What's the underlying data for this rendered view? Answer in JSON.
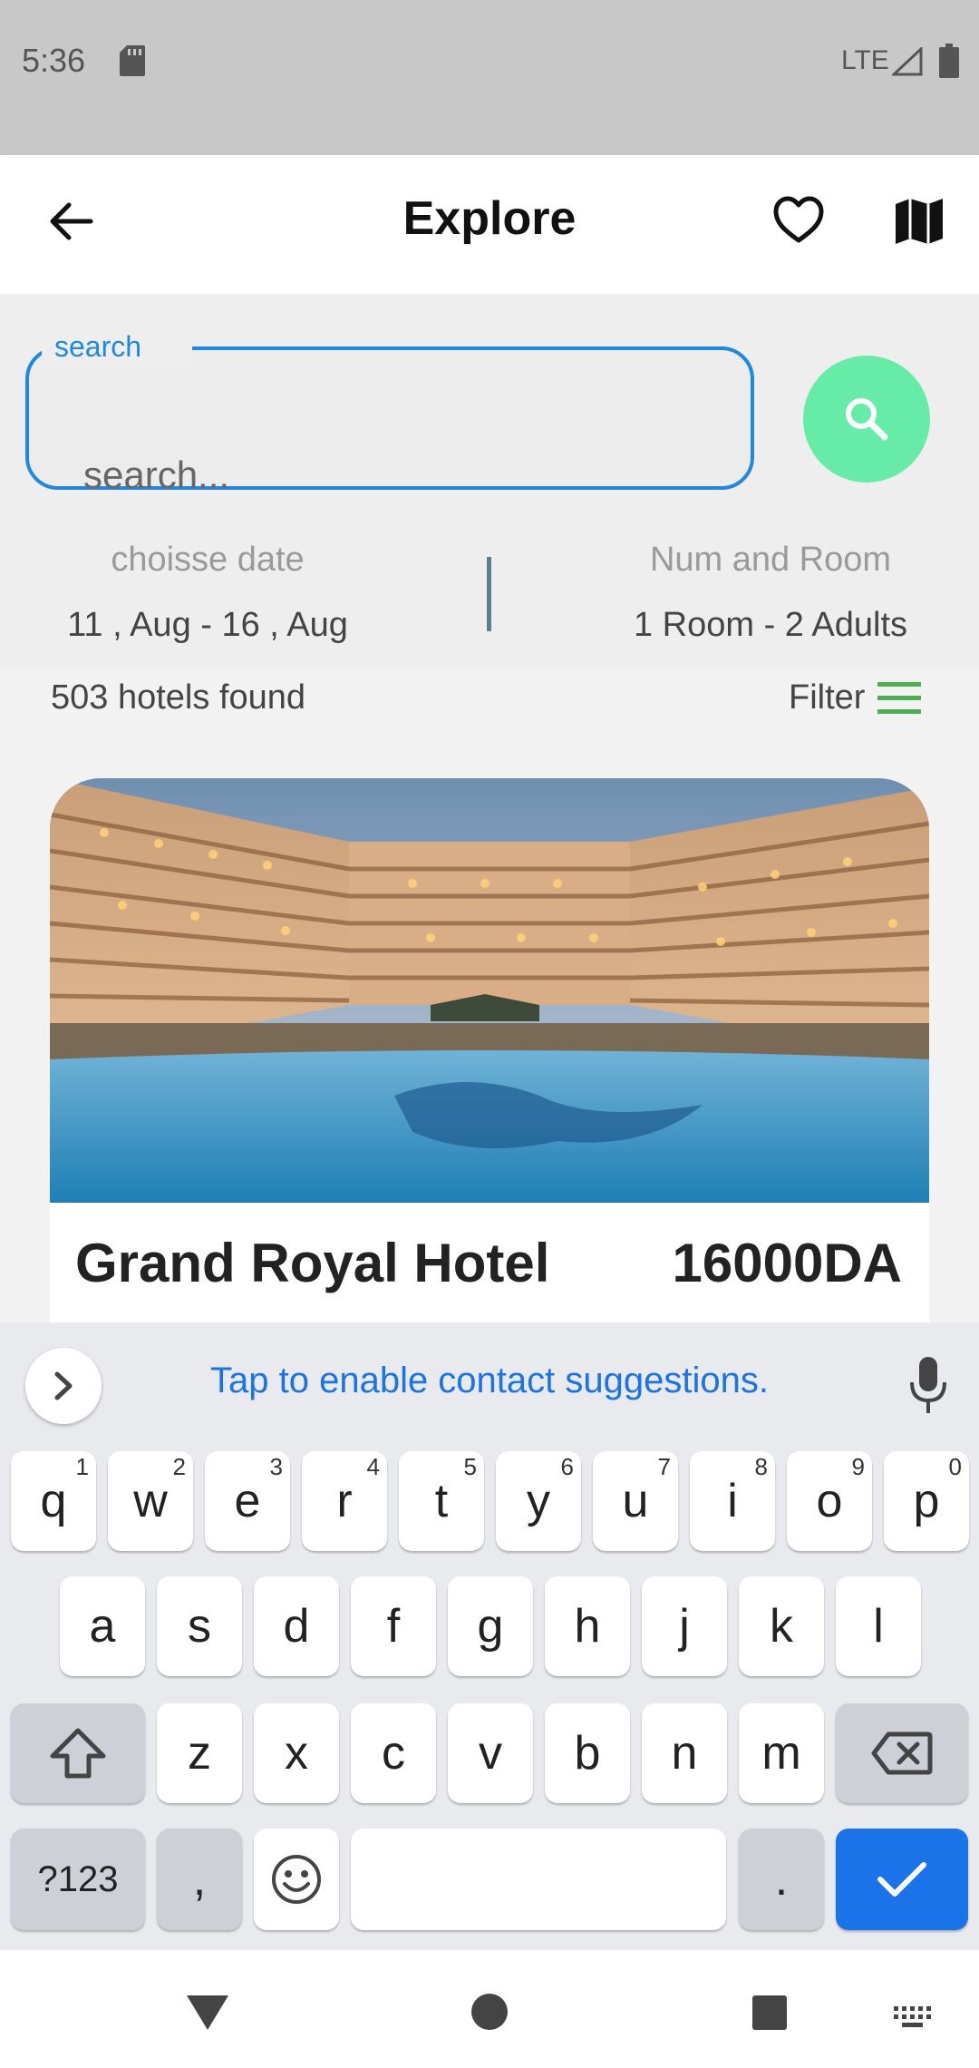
{
  "status_bar": {
    "time": "5:36",
    "network": "LTE"
  },
  "app_bar": {
    "title": "Explore"
  },
  "search": {
    "label": "search",
    "placeholder": "search..."
  },
  "booking": {
    "date_label": "choisse date",
    "date_value": "11 , Aug - 16 , Aug",
    "room_label": "Num and Room",
    "room_value": "1 Room - 2 Adults"
  },
  "results": {
    "count_text": "503 hotels found",
    "filter_label": "Filter"
  },
  "hotel_card": {
    "name": "Grand Royal Hotel",
    "price": "16000DA"
  },
  "keyboard": {
    "suggestion": "Tap to enable contact suggestions.",
    "row1": [
      {
        "key": "q",
        "hint": "1"
      },
      {
        "key": "w",
        "hint": "2"
      },
      {
        "key": "e",
        "hint": "3"
      },
      {
        "key": "r",
        "hint": "4"
      },
      {
        "key": "t",
        "hint": "5"
      },
      {
        "key": "y",
        "hint": "6"
      },
      {
        "key": "u",
        "hint": "7"
      },
      {
        "key": "i",
        "hint": "8"
      },
      {
        "key": "o",
        "hint": "9"
      },
      {
        "key": "p",
        "hint": "0"
      }
    ],
    "row2": [
      "a",
      "s",
      "d",
      "f",
      "g",
      "h",
      "j",
      "k",
      "l"
    ],
    "row3": [
      "z",
      "x",
      "c",
      "v",
      "b",
      "n",
      "m"
    ],
    "symbols_label": "?123",
    "comma_label": ",",
    "period_label": "."
  },
  "colors": {
    "accent_blue": "#1e88e5",
    "search_button": "#67eca8",
    "filter_icon": "#4caf50",
    "keyboard_action": "#1a73e8"
  }
}
